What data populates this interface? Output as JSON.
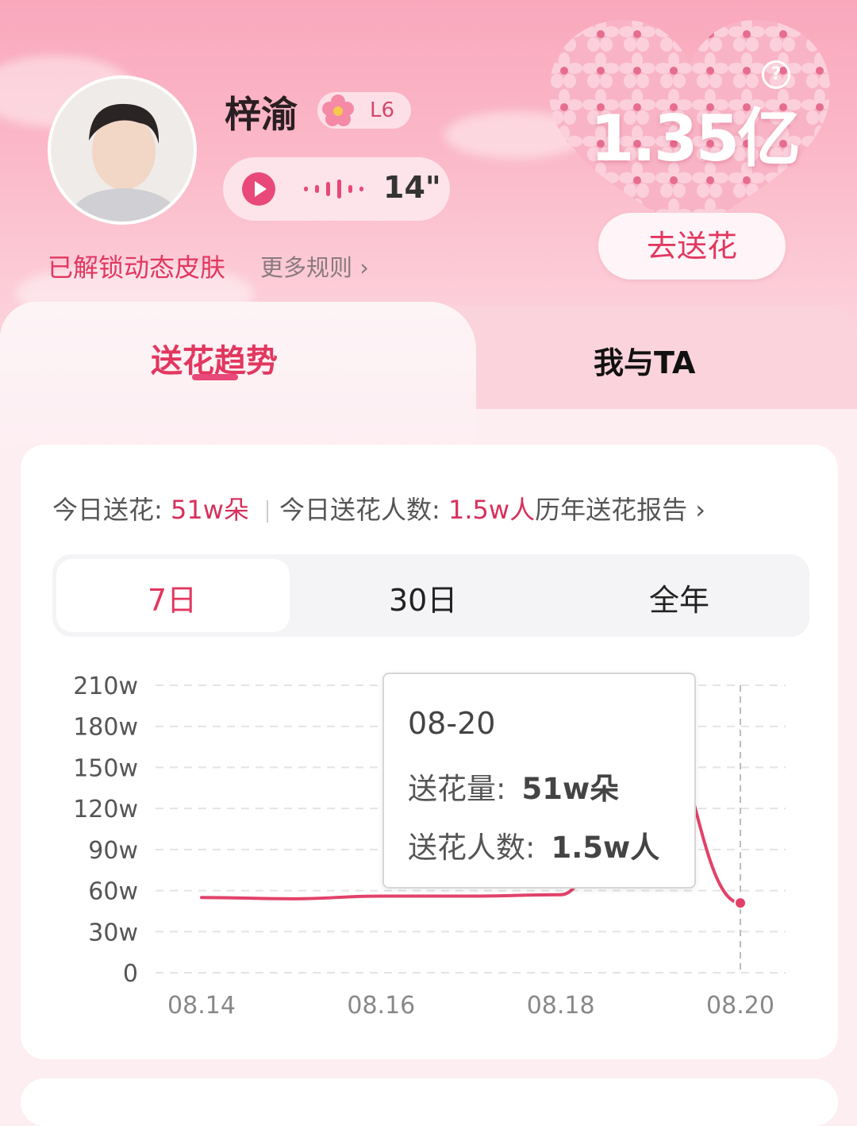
{
  "profile": {
    "name": "梓渝",
    "level": "L6",
    "voice_duration": "14\"",
    "unlocked_text": "已解锁动态皮肤",
    "more_rules": "更多规则 ›"
  },
  "flower_total": {
    "count": "1.35亿",
    "help": "?",
    "send_button": "去送花"
  },
  "tabs": [
    {
      "label": "送花趋势",
      "active": true
    },
    {
      "label": "我与TA",
      "active": false
    }
  ],
  "stats": {
    "today_label": "今日送花:",
    "today_value": "51w朵",
    "people_label": "今日送花人数:",
    "people_value": "1.5w人",
    "report_link": "历年送花报告 ›"
  },
  "ranges": [
    {
      "label": "7日",
      "active": true
    },
    {
      "label": "30日",
      "active": false
    },
    {
      "label": "全年",
      "active": false
    }
  ],
  "tooltip": {
    "date": "08-20",
    "amount_label": "送花量:",
    "amount_value": "51w朵",
    "people_label": "送花人数:",
    "people_value": "1.5w人"
  },
  "colors": {
    "accent": "#e2375f",
    "line": "#e2426a"
  },
  "chart_data": {
    "type": "line",
    "x": [
      "08.14",
      "08.15",
      "08.16",
      "08.17",
      "08.18",
      "08.19",
      "08.20"
    ],
    "x_tick_labels": [
      "08.14",
      "08.16",
      "08.18",
      "08.20"
    ],
    "series": [
      {
        "values": [
          55,
          54,
          56,
          56,
          57,
          188,
          51
        ]
      }
    ],
    "y_ticks": [
      "210w",
      "180w",
      "150w",
      "120w",
      "90w",
      "60w",
      "30w",
      "0"
    ],
    "ylim": [
      0,
      210
    ],
    "grid": true,
    "highlighted_point": "08.20"
  }
}
